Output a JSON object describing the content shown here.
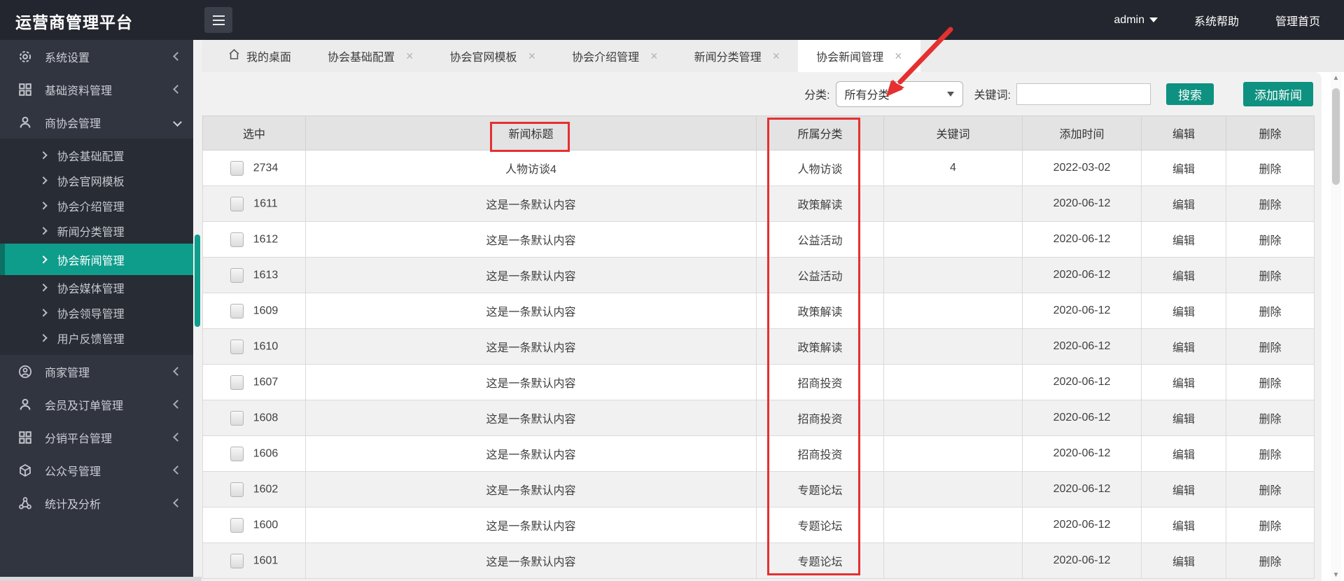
{
  "header": {
    "title": "运营商管理平台",
    "user": "admin",
    "links": [
      {
        "label": "系统帮助"
      },
      {
        "label": "管理首页"
      }
    ]
  },
  "sidebar": {
    "items": [
      {
        "label": "系统设置",
        "icon": "gear-icon"
      },
      {
        "label": "基础资料管理",
        "icon": "grid-icon"
      },
      {
        "label": "商协会管理",
        "icon": "user-icon"
      },
      {
        "label": "商家管理",
        "icon": "user-circle-icon"
      },
      {
        "label": "会员及订单管理",
        "icon": "user-icon"
      },
      {
        "label": "分销平台管理",
        "icon": "grid-icon"
      },
      {
        "label": "公众号管理",
        "icon": "cube-icon"
      },
      {
        "label": "统计及分析",
        "icon": "share-icon"
      }
    ],
    "submenu": [
      {
        "label": "协会基础配置"
      },
      {
        "label": "协会官网模板"
      },
      {
        "label": "协会介绍管理"
      },
      {
        "label": "新闻分类管理"
      },
      {
        "label": "协会新闻管理"
      },
      {
        "label": "协会媒体管理"
      },
      {
        "label": "协会领导管理"
      },
      {
        "label": "用户反馈管理"
      }
    ],
    "active_submenu": "协会新闻管理"
  },
  "tabs": {
    "home": "我的桌面",
    "close_glyph": "×",
    "items": [
      {
        "label": "协会基础配置"
      },
      {
        "label": "协会官网模板"
      },
      {
        "label": "协会介绍管理"
      },
      {
        "label": "新闻分类管理"
      },
      {
        "label": "协会新闻管理"
      }
    ],
    "active": "协会新闻管理"
  },
  "filter": {
    "category_label": "分类:",
    "category_value": "所有分类",
    "keyword_label": "关键词:",
    "keyword_value": "",
    "search_button": "搜索",
    "add_button": "添加新闻"
  },
  "table": {
    "columns": [
      "选中",
      "新闻标题",
      "所属分类",
      "关键词",
      "添加时间",
      "编辑",
      "删除"
    ],
    "edit_label": "编辑",
    "delete_label": "删除",
    "rows": [
      {
        "id": "2734",
        "title": "人物访谈4",
        "category": "人物访谈",
        "keyword": "4",
        "date": "2022-03-02"
      },
      {
        "id": "1611",
        "title": "这是一条默认内容",
        "category": "政策解读",
        "keyword": "",
        "date": "2020-06-12"
      },
      {
        "id": "1612",
        "title": "这是一条默认内容",
        "category": "公益活动",
        "keyword": "",
        "date": "2020-06-12"
      },
      {
        "id": "1613",
        "title": "这是一条默认内容",
        "category": "公益活动",
        "keyword": "",
        "date": "2020-06-12"
      },
      {
        "id": "1609",
        "title": "这是一条默认内容",
        "category": "政策解读",
        "keyword": "",
        "date": "2020-06-12"
      },
      {
        "id": "1610",
        "title": "这是一条默认内容",
        "category": "政策解读",
        "keyword": "",
        "date": "2020-06-12"
      },
      {
        "id": "1607",
        "title": "这是一条默认内容",
        "category": "招商投资",
        "keyword": "",
        "date": "2020-06-12"
      },
      {
        "id": "1608",
        "title": "这是一条默认内容",
        "category": "招商投资",
        "keyword": "",
        "date": "2020-06-12"
      },
      {
        "id": "1606",
        "title": "这是一条默认内容",
        "category": "招商投资",
        "keyword": "",
        "date": "2020-06-12"
      },
      {
        "id": "1602",
        "title": "这是一条默认内容",
        "category": "专题论坛",
        "keyword": "",
        "date": "2020-06-12"
      },
      {
        "id": "1600",
        "title": "这是一条默认内容",
        "category": "专题论坛",
        "keyword": "",
        "date": "2020-06-12"
      },
      {
        "id": "1601",
        "title": "这是一条默认内容",
        "category": "专题论坛",
        "keyword": "",
        "date": "2020-06-12"
      }
    ]
  },
  "scrollbar": {
    "up": "▲",
    "down": "▼"
  },
  "colors": {
    "accent_active": "#0e9c8b",
    "accent_button": "#0e9180",
    "annotation_red": "#e53030",
    "header_bg": "#23262e",
    "sidebar_bg": "#313540"
  }
}
